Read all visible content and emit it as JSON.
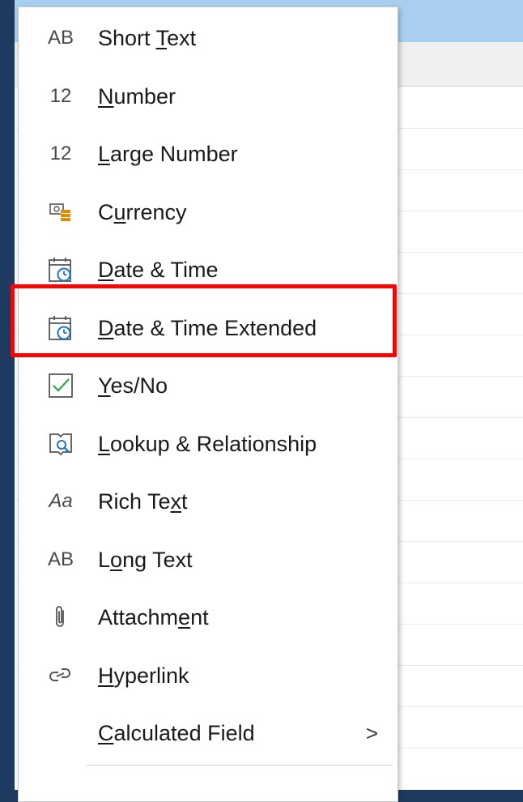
{
  "menu": {
    "items": [
      {
        "id": "short-text",
        "icon": "ab-text-icon",
        "icon_text": "AB",
        "label_pre": "Short ",
        "label_key": "T",
        "label_post": "ext"
      },
      {
        "id": "number",
        "icon": "number-icon",
        "icon_text": "12",
        "label_pre": "",
        "label_key": "N",
        "label_post": "umber"
      },
      {
        "id": "large-number",
        "icon": "number-icon",
        "icon_text": "12",
        "label_pre": "",
        "label_key": "L",
        "label_post": "arge Number"
      },
      {
        "id": "currency",
        "icon": "currency-icon",
        "icon_text": "",
        "label_pre": "C",
        "label_key": "u",
        "label_post": "rrency"
      },
      {
        "id": "date-time",
        "icon": "calendar-clock-icon",
        "icon_text": "",
        "label_pre": "",
        "label_key": "D",
        "label_post": "ate & Time"
      },
      {
        "id": "date-time-extended",
        "icon": "calendar-clock-icon",
        "icon_text": "",
        "label_pre": "",
        "label_key": "D",
        "label_post": "ate & Time Extended"
      },
      {
        "id": "yes-no",
        "icon": "checkbox-icon",
        "icon_text": "",
        "label_pre": "",
        "label_key": "Y",
        "label_post": "es/No"
      },
      {
        "id": "lookup-relationship",
        "icon": "lookup-icon",
        "icon_text": "",
        "label_pre": "",
        "label_key": "L",
        "label_post": "ookup & Relationship"
      },
      {
        "id": "rich-text",
        "icon": "rich-text-icon",
        "icon_text": "Aa",
        "label_pre": "Rich Te",
        "label_key": "x",
        "label_post": "t"
      },
      {
        "id": "long-text",
        "icon": "ab-text-icon",
        "icon_text": "AB",
        "label_pre": "L",
        "label_key": "o",
        "label_post": "ng Text"
      },
      {
        "id": "attachment",
        "icon": "paperclip-icon",
        "icon_text": "",
        "label_pre": "Attachm",
        "label_key": "e",
        "label_post": "nt"
      },
      {
        "id": "hyperlink",
        "icon": "link-icon",
        "icon_text": "",
        "label_pre": "",
        "label_key": "H",
        "label_post": "yperlink"
      },
      {
        "id": "calculated-field",
        "icon": "",
        "icon_text": "",
        "label_pre": "",
        "label_key": "C",
        "label_post": "alculated Field",
        "submenu_arrow": ">"
      }
    ]
  },
  "colors": {
    "highlight": "#ff0000",
    "accent_blue": "#1e74c7",
    "accent_orange": "#e68a00",
    "check_green": "#2ea44f"
  }
}
